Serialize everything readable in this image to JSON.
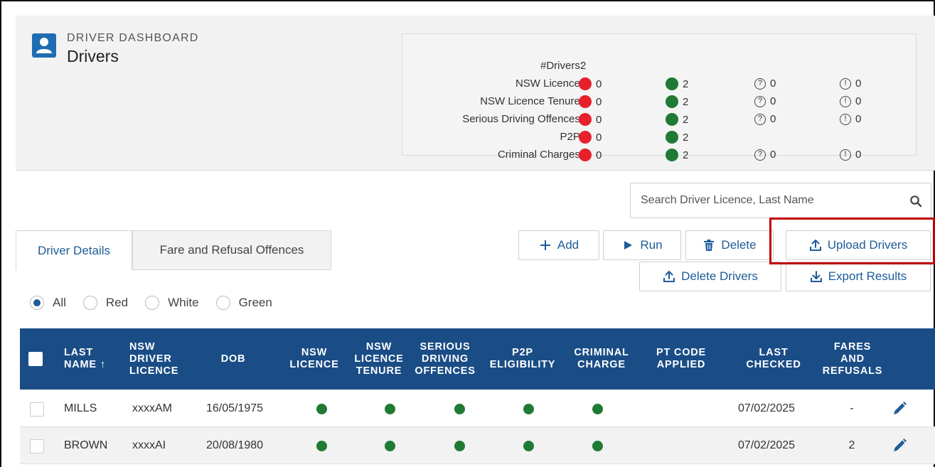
{
  "header": {
    "eyebrow": "DRIVER DASHBOARD",
    "title": "Drivers"
  },
  "summary": {
    "drivers_label": "#Drivers:",
    "drivers_count": "2",
    "rows": [
      {
        "label": "NSW Licence:",
        "red": "0",
        "green": "2",
        "unknown": "0",
        "info": "0"
      },
      {
        "label": "NSW Licence Tenure:",
        "red": "0",
        "green": "2",
        "unknown": "0",
        "info": "0"
      },
      {
        "label": "Serious Driving Offences:",
        "red": "0",
        "green": "2",
        "unknown": "0",
        "info": "0"
      },
      {
        "label": "P2P:",
        "red": "0",
        "green": "2"
      },
      {
        "label": "Criminal Charges:",
        "red": "0",
        "green": "2",
        "unknown": "0",
        "info": "0"
      }
    ],
    "colors": {
      "red": "#e8202b",
      "green": "#1f7a34"
    }
  },
  "search": {
    "placeholder": "Search Driver Licence, Last Name",
    "value": ""
  },
  "tabs": [
    {
      "label": "Driver Details",
      "active": true
    },
    {
      "label": "Fare and Refusal Offences",
      "active": false
    }
  ],
  "toolbar": {
    "add_label": "Add",
    "run_label": "Run",
    "delete_label": "Delete",
    "upload_label": "Upload Drivers",
    "delete_drivers_label": "Delete Drivers",
    "export_label": "Export Results"
  },
  "filters": [
    {
      "label": "All",
      "selected": true
    },
    {
      "label": "Red",
      "selected": false
    },
    {
      "label": "White",
      "selected": false
    },
    {
      "label": "Green",
      "selected": false
    }
  ],
  "table": {
    "columns": [
      "LAST\nNAME ↑",
      "NSW\nDRIVER\nLICENCE",
      "DOB",
      "NSW\nLICENCE",
      "NSW\nLICENCE\nTENURE",
      "SERIOUS\nDRIVING\nOFFENCES",
      "P2P\nELIGIBILITY",
      "CRIMINAL\nCHARGE",
      "PT CODE\nAPPLIED",
      "LAST\nCHECKED",
      "FARES\nAND\nREFUSALS"
    ],
    "rows": [
      {
        "last_name": "MILLS",
        "licence": "xxxxAM",
        "dob": "16/05/1975",
        "pt_code": "",
        "last_checked": "07/02/2025",
        "fares": "-"
      },
      {
        "last_name": "BROWN",
        "licence": "xxxxAI",
        "dob": "20/08/1980",
        "pt_code": "",
        "last_checked": "07/02/2025",
        "fares": "2"
      }
    ]
  },
  "icons": {
    "user": "user-icon",
    "search": "search-icon",
    "add": "plus-icon",
    "run": "play-icon",
    "delete": "trash-icon",
    "upload": "upload-icon",
    "export": "download-icon",
    "edit": "pencil-icon"
  },
  "accent_color": "#1e5c99",
  "table_header_color": "#1a4d86",
  "highlight_color": "#c00000"
}
